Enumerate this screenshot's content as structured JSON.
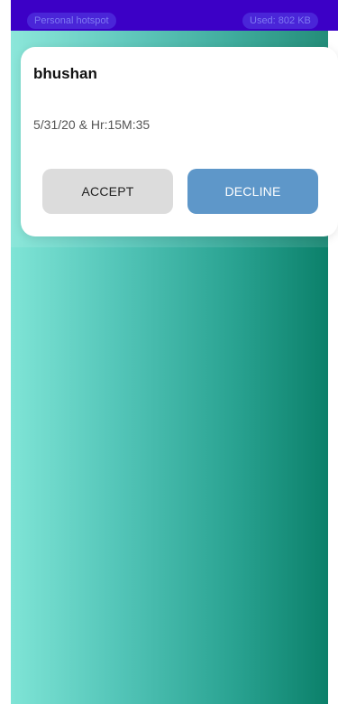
{
  "status_bar": {
    "left_pill": "Personal hotspot",
    "right_pill": "Used: 802 KB"
  },
  "dialog": {
    "title": "bhushan",
    "datetime": "5/31/20  &  Hr:15M:35",
    "accept_label": "ACCEPT",
    "decline_label": "DECLINE"
  },
  "colors": {
    "status_bar": "#3c00c6",
    "gradient_start": "#7fe4d6",
    "gradient_end": "#0b806a",
    "decline_button": "#5e97c9",
    "accept_button": "#dcdcdc"
  }
}
